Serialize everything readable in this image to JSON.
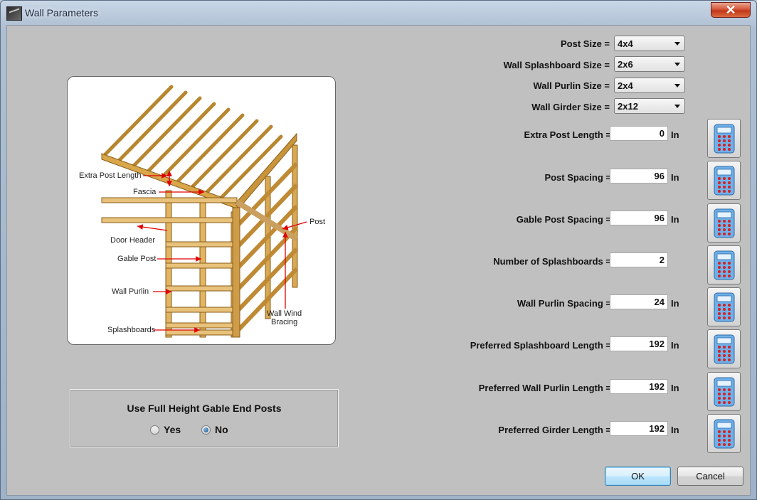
{
  "window": {
    "title": "Wall Parameters",
    "close_label": "✕"
  },
  "illustration": {
    "callouts": {
      "extra_post_length": "Extra Post Length",
      "fascia": "Fascia",
      "door_header": "Door Header",
      "gable_post": "Gable Post",
      "wall_purlin": "Wall Purlin",
      "splashboards": "Splashboards",
      "post": "Post",
      "wall_wind_bracing_1": "Wall Wind",
      "wall_wind_bracing_2": "Bracing"
    }
  },
  "gable_end_posts": {
    "title": "Use Full Height Gable End Posts",
    "options": [
      {
        "label": "Yes",
        "selected": false
      },
      {
        "label": "No",
        "selected": true
      }
    ]
  },
  "dropdowns": [
    {
      "label": "Post Size =",
      "value": "4x4"
    },
    {
      "label": "Wall Splashboard Size =",
      "value": "2x6"
    },
    {
      "label": "Wall Purlin Size =",
      "value": "2x4"
    },
    {
      "label": "Wall Girder Size =",
      "value": "2x12"
    }
  ],
  "fields": [
    {
      "label": "Extra Post Length =",
      "value": "0",
      "unit": "In"
    },
    {
      "label": "Post Spacing =",
      "value": "96",
      "unit": "In"
    },
    {
      "label": "Gable Post Spacing =",
      "value": "96",
      "unit": "In"
    },
    {
      "label": "Number of Splashboards =",
      "value": "2",
      "unit": ""
    },
    {
      "label": "Wall Purlin Spacing =",
      "value": "24",
      "unit": "In"
    },
    {
      "label": "Preferred Splashboard Length =",
      "value": "192",
      "unit": "In"
    },
    {
      "label": "Preferred Wall Purlin Length =",
      "value": "192",
      "unit": "In"
    },
    {
      "label": "Preferred Girder Length =",
      "value": "192",
      "unit": "In"
    }
  ],
  "buttons": {
    "ok": "OK",
    "cancel": "Cancel"
  },
  "icons": {
    "calculator": "calculator-icon",
    "close": "close-icon",
    "app": "app-icon"
  }
}
